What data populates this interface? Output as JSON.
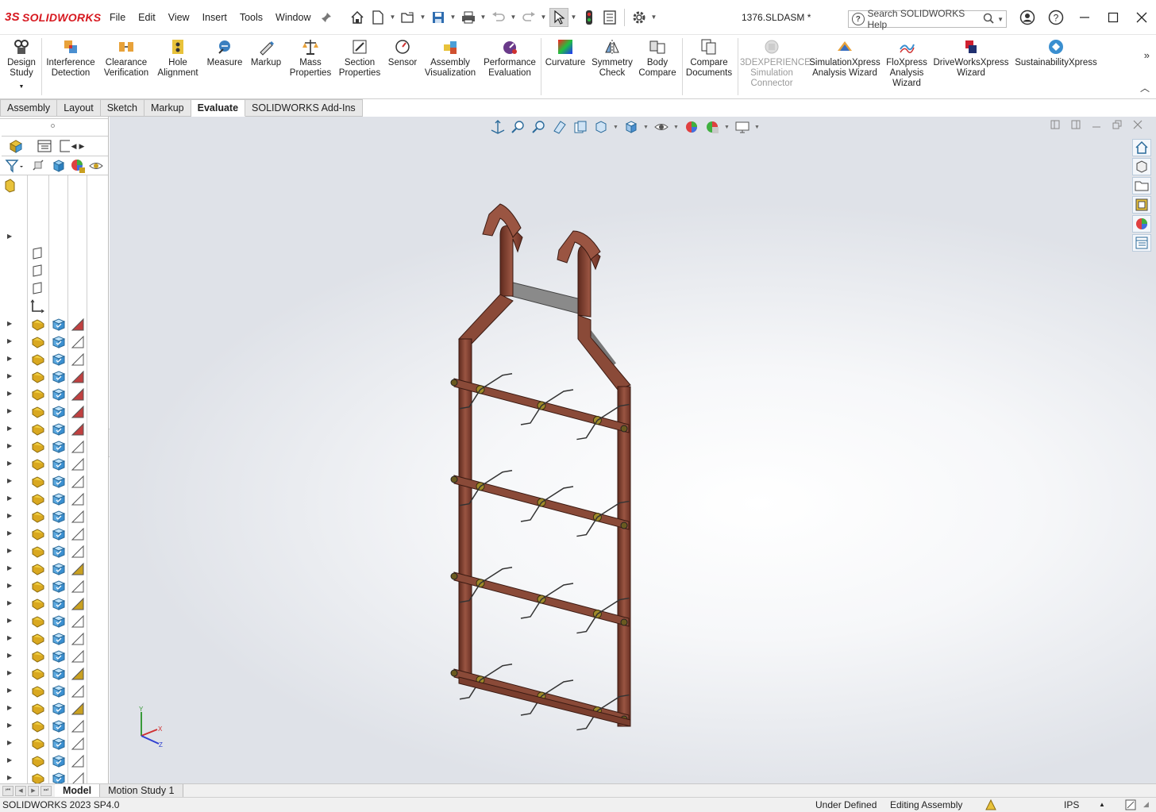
{
  "app": {
    "brand": "SOLIDWORKS",
    "brand_mark": "3S",
    "document_title": "1376.SLDASM *"
  },
  "menu": [
    "File",
    "Edit",
    "View",
    "Insert",
    "Tools",
    "Window"
  ],
  "search": {
    "placeholder": "Search SOLIDWORKS Help"
  },
  "ribbon": {
    "design_study": [
      "Design",
      "Study"
    ],
    "interference": [
      "Interference",
      "Detection"
    ],
    "clearance": [
      "Clearance",
      "Verification"
    ],
    "hole_alignment": [
      "Hole",
      "Alignment"
    ],
    "measure": "Measure",
    "markup": "Markup",
    "mass_properties": [
      "Mass",
      "Properties"
    ],
    "section_properties": [
      "Section",
      "Properties"
    ],
    "sensor": "Sensor",
    "assembly_visualization": [
      "Assembly",
      "Visualization"
    ],
    "performance_evaluation": [
      "Performance",
      "Evaluation"
    ],
    "curvature": "Curvature",
    "symmetry_check": [
      "Symmetry",
      "Check"
    ],
    "body_compare": [
      "Body",
      "Compare"
    ],
    "compare_documents": [
      "Compare",
      "Documents"
    ],
    "experience_sim": [
      "3DEXPERIENCE",
      "Simulation",
      "Connector"
    ],
    "simulationxpress": [
      "SimulationXpress",
      "Analysis Wizard"
    ],
    "floxpress": [
      "FloXpress",
      "Analysis",
      "Wizard"
    ],
    "driveworksxpress": [
      "DriveWorksXpress",
      "Wizard"
    ],
    "sustainabilityxpress": "SustainabilityXpress"
  },
  "tabs": [
    "Assembly",
    "Layout",
    "Sketch",
    "Markup",
    "Evaluate",
    "SOLIDWORKS Add-Ins"
  ],
  "active_tab": "Evaluate",
  "bottom_tabs": [
    "Model",
    "Motion Study 1"
  ],
  "status": {
    "version": "SOLIDWORKS 2023 SP4.0",
    "definition": "Under Defined",
    "mode": "Editing Assembly",
    "units": "IPS"
  },
  "colors": {
    "brand_red": "#d71920",
    "frame_copper": "#8b4a3a",
    "part_yellow": "#e8c23a",
    "cube_blue": "#4a9fd8"
  },
  "triad": {
    "x": "X",
    "y": "Y",
    "z": "Z"
  }
}
